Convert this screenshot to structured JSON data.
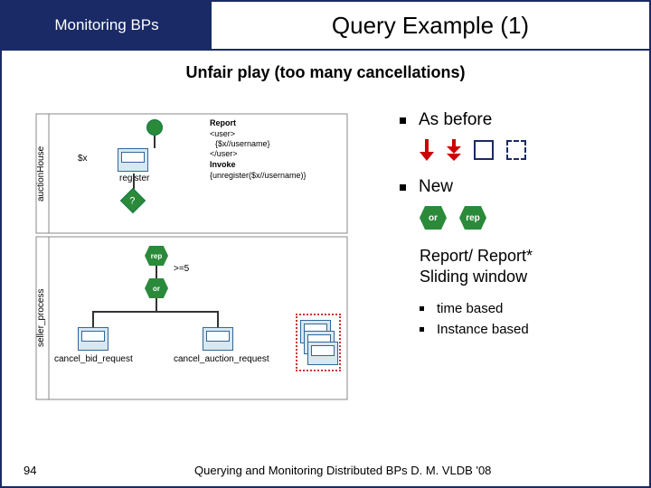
{
  "header": {
    "left": "Monitoring  BPs",
    "title": "Query Example (1)"
  },
  "subtitle": "Unfair play (too many cancellations)",
  "right": {
    "as_before": "As before",
    "new_label": "New",
    "hex_or": "or",
    "hex_rep": "rep",
    "report_line1": "Report/ Report*",
    "report_line2": "Sliding window",
    "sub_bullets": {
      "time": "time based",
      "instance": "Instance based"
    }
  },
  "diagram": {
    "lane1": "auctionHouse",
    "lane2": "seller_process",
    "var_x": "$x",
    "register": "register",
    "report_title": "Report",
    "report_l1": "<user>",
    "report_l2": "  {$x//username}",
    "report_l3": "</user>",
    "invoke": "Invoke",
    "invoke_l1": "{unregister($x//username)}",
    "rep": "rep",
    "threshold": ">=5",
    "or": "or",
    "cancel_bid": "cancel_bid_request",
    "cancel_auction": "cancel_auction_request",
    "diamond_q": "?"
  },
  "footer": {
    "page": "94",
    "text": "Querying and Monitoring Distributed BPs D. M. VLDB '08"
  }
}
